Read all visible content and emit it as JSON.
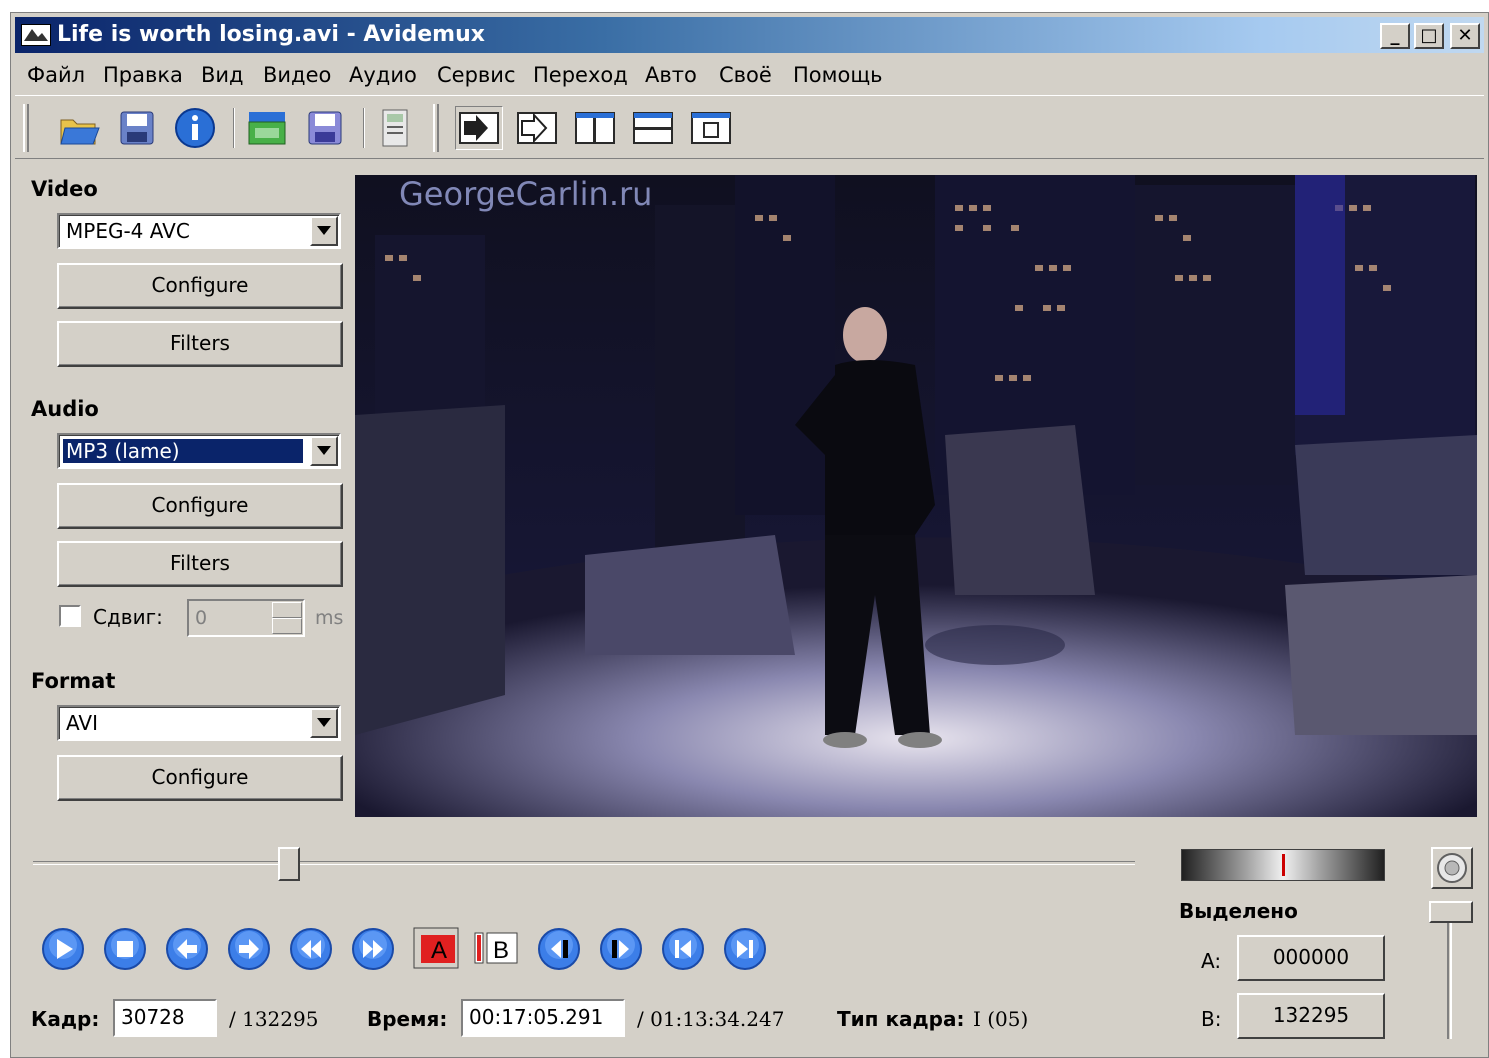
{
  "window": {
    "title": "Life is worth losing.avi - Avidemux",
    "minimize": "_",
    "maximize": "□",
    "close": "✕"
  },
  "menu": [
    "Файл",
    "Правка",
    "Вид",
    "Видео",
    "Аудио",
    "Сервис",
    "Переход",
    "Авто",
    "Своё",
    "Помощь"
  ],
  "toolbar": {
    "icons": [
      "open-icon",
      "save-icon",
      "info-icon",
      "open-folder-icon",
      "save-video-icon",
      "calculator-icon",
      "view-input-icon",
      "view-output-icon",
      "view-side-by-side-icon",
      "view-top-bottom-icon",
      "view-single-icon"
    ]
  },
  "video_section": {
    "title": "Video",
    "codec": "MPEG-4 AVC",
    "configure": "Configure",
    "filters": "Filters"
  },
  "audio_section": {
    "title": "Audio",
    "codec": "MP3 (lame)",
    "configure": "Configure",
    "filters": "Filters",
    "shift_label": "Сдвиг:",
    "shift_value": "0",
    "shift_unit": "ms",
    "shift_checked": false
  },
  "format_section": {
    "title": "Format",
    "container": "AVI",
    "configure": "Configure"
  },
  "preview": {
    "watermark": "GeorgeCarlin.ru"
  },
  "timeline": {
    "position_fraction": 0.232
  },
  "selection": {
    "title": "Выделено",
    "a_label": "A:",
    "a_value": "000000",
    "b_label": "B:",
    "b_value": "132295"
  },
  "status": {
    "frame_label": "Кадр:",
    "frame_value": "30728",
    "frame_total": "/ 132295",
    "time_label": "Время:",
    "time_value": "00:17:05.291",
    "time_total": "/ 01:13:34.247",
    "frame_type_label": "Тип кадра:",
    "frame_type_value": "I (05)"
  },
  "marker_labels": {
    "a": "A",
    "b": "B"
  },
  "colors": {
    "accent_blue": "#2a6fd6",
    "marker_red": "#e02020"
  }
}
